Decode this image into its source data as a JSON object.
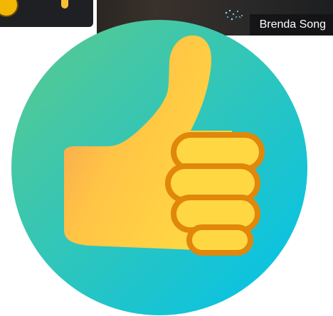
{
  "participant": {
    "name": "Brenda Song"
  },
  "reaction": {
    "icon": "thumbs-up-icon",
    "circle_gradient": [
      "#5cc98c",
      "#00c2ec"
    ],
    "thumb_gradient": [
      "#f79a56",
      "#ffd340"
    ],
    "outline_color": "#e1870a",
    "finger_fill": "#ffd743"
  },
  "colors": {
    "tile_background": "#1f2024",
    "name_tag_background": "#141416",
    "name_tag_text": "#ffffff"
  }
}
